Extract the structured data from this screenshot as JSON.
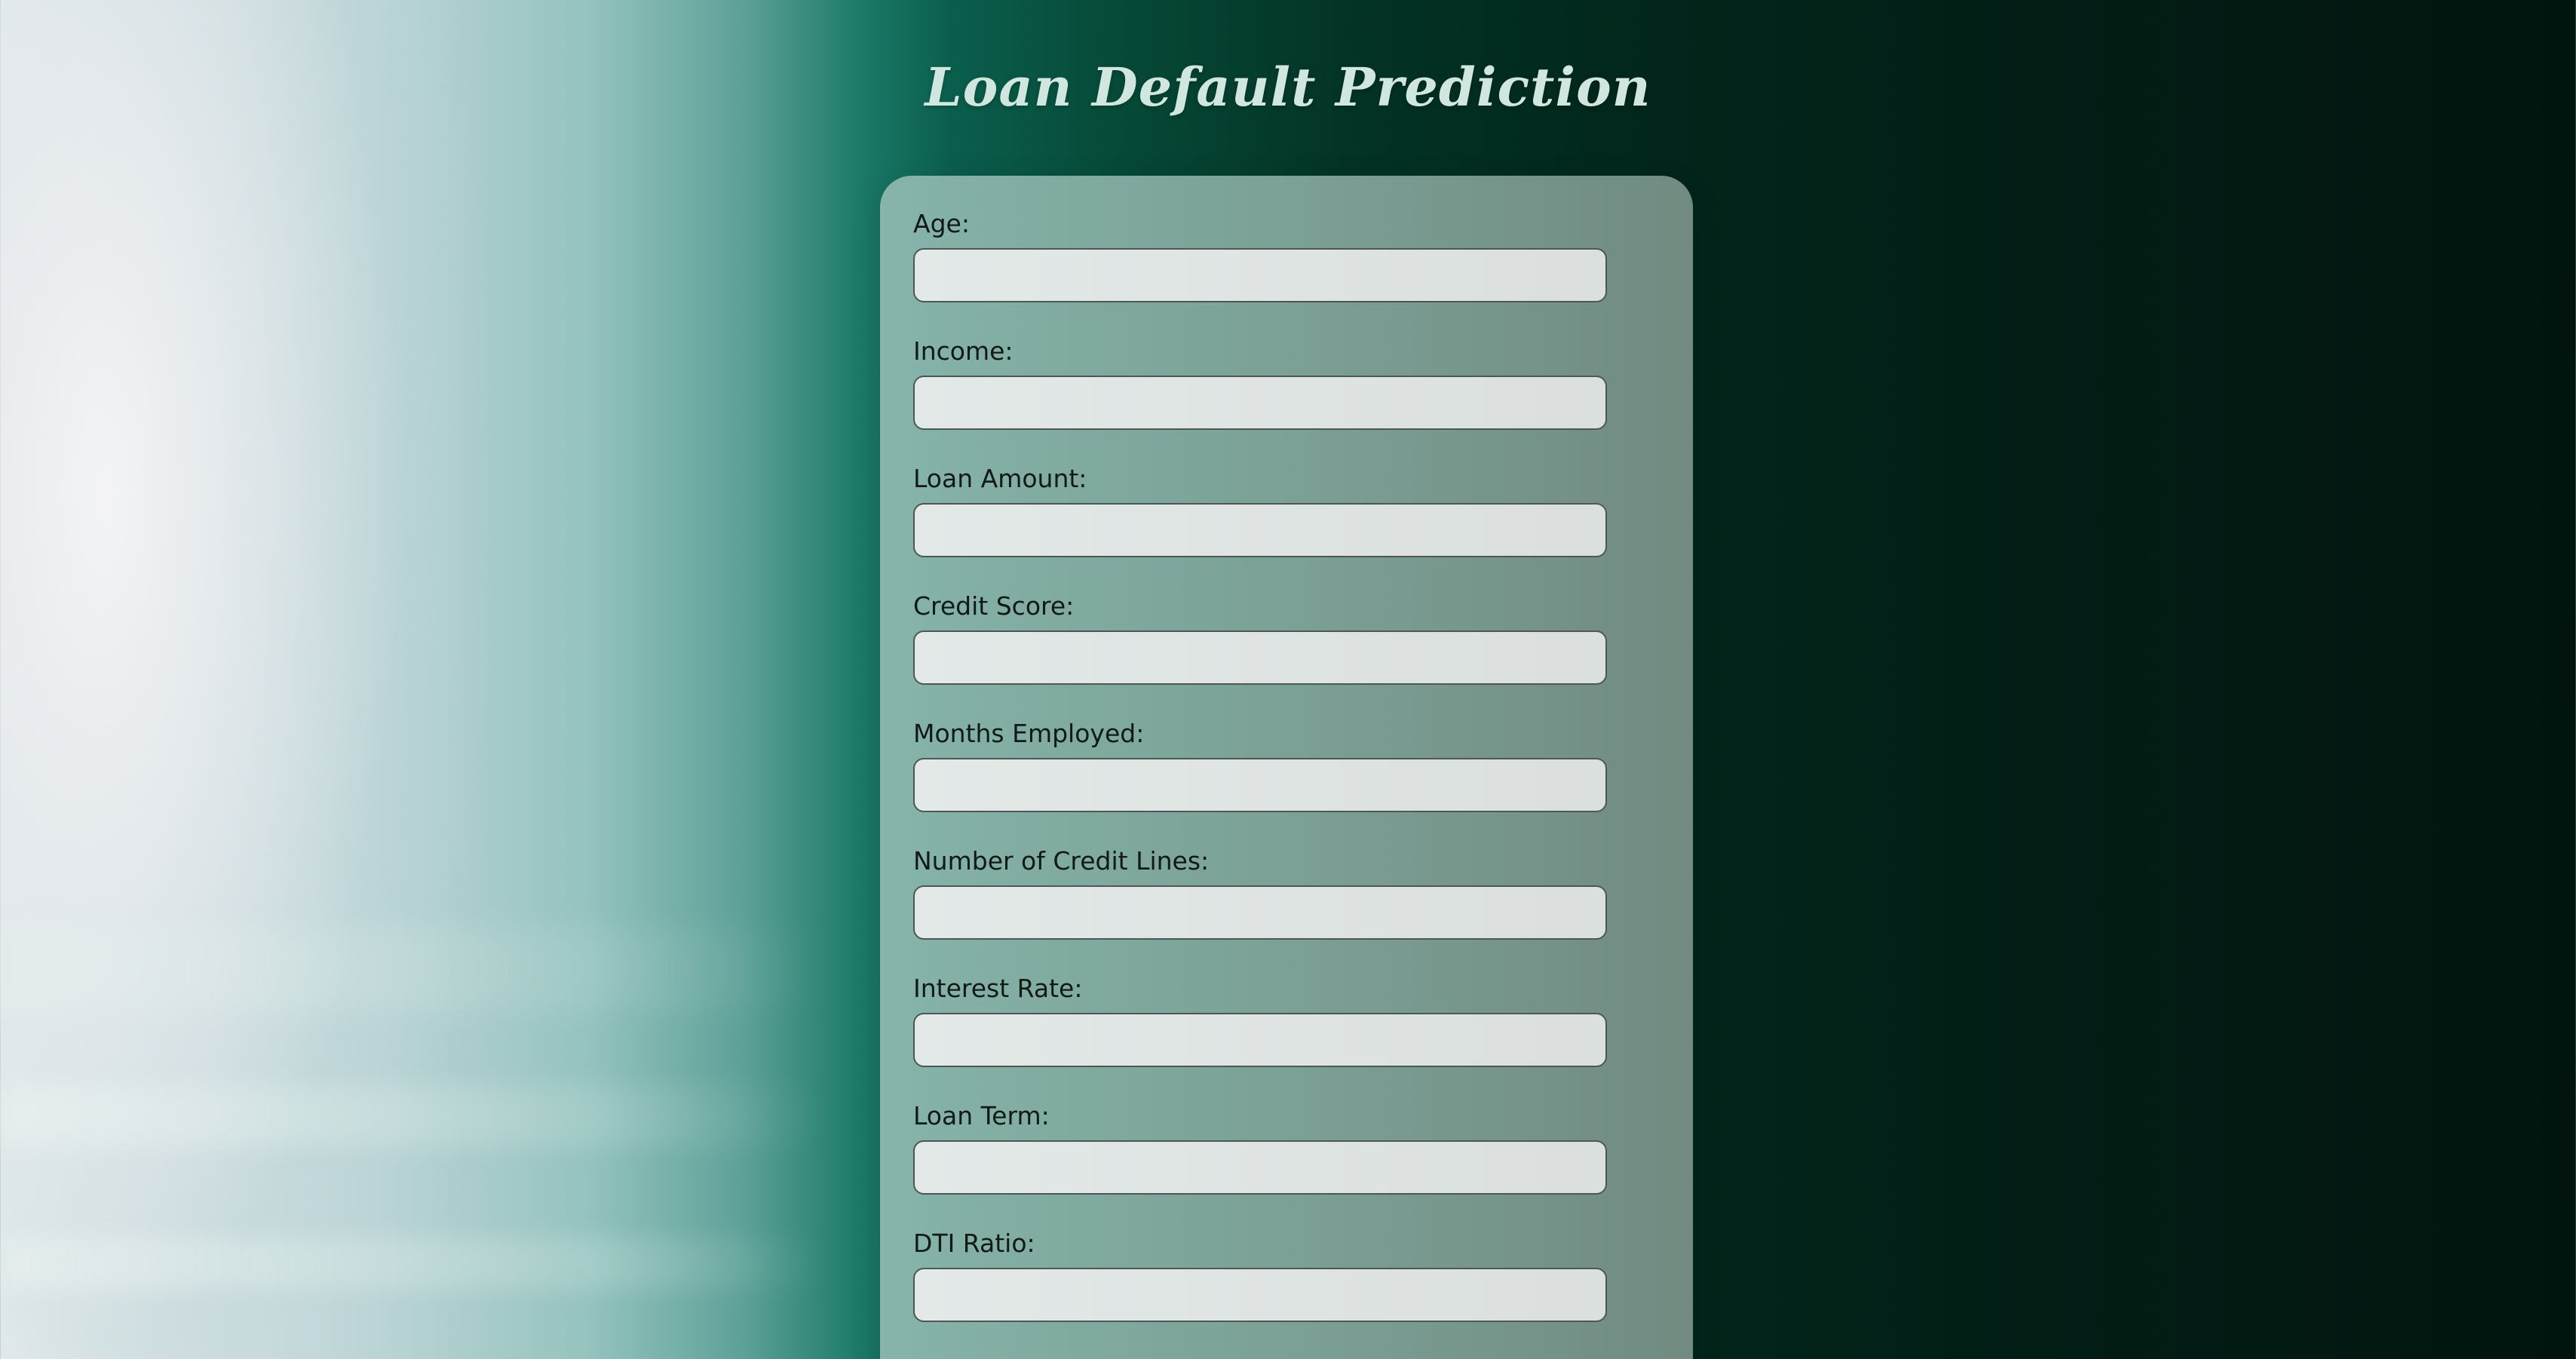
{
  "page": {
    "title": "Loan Default Prediction"
  },
  "form": {
    "fields": [
      {
        "label": "Age:",
        "value": ""
      },
      {
        "label": "Income:",
        "value": ""
      },
      {
        "label": "Loan Amount:",
        "value": ""
      },
      {
        "label": "Credit Score:",
        "value": ""
      },
      {
        "label": "Months Employed:",
        "value": ""
      },
      {
        "label": "Number of Credit Lines:",
        "value": ""
      },
      {
        "label": "Interest Rate:",
        "value": ""
      },
      {
        "label": "Loan Term:",
        "value": ""
      },
      {
        "label": "DTI Ratio:",
        "value": ""
      }
    ]
  },
  "colors": {
    "title": "#cfe7df",
    "background_dark": "#02140e",
    "background_light": "#eef0f2",
    "card": "#8fb3a8",
    "input_border": "#4d5753"
  }
}
